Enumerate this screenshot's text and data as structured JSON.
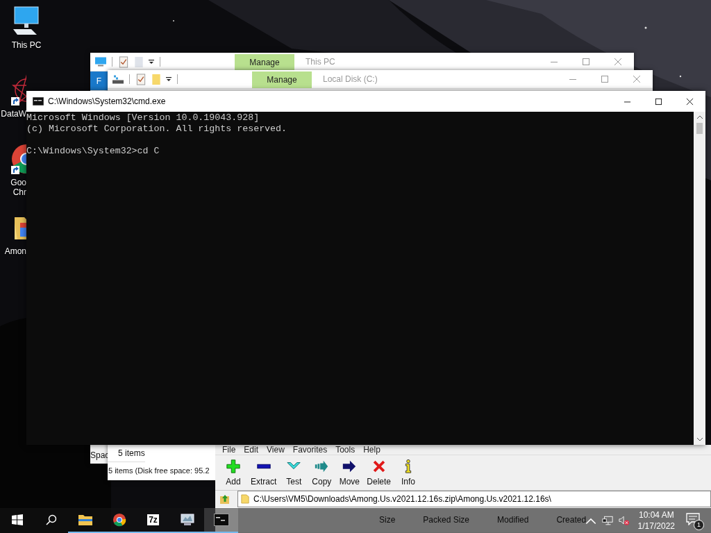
{
  "desktop_icons": [
    {
      "kind": "computer",
      "shortcut": false,
      "label_lines": [
        "This PC"
      ]
    },
    {
      "kind": "app",
      "shortcut": true,
      "label_lines": [
        "DataW"
      ]
    },
    {
      "kind": "chrome",
      "shortcut": true,
      "label_lines": [
        "Goo",
        "Chr"
      ]
    },
    {
      "kind": "folder",
      "shortcut": false,
      "label_lines": [
        "Amon"
      ]
    }
  ],
  "explorer_windows": [
    {
      "title": "This PC",
      "kind": "computer",
      "ribbon_tab": "Manage",
      "file_tab": "F",
      "status_lines": [
        "Spac"
      ]
    },
    {
      "title": "Local Disk (C:)",
      "kind": "drive",
      "ribbon_tab": "Manage",
      "status_lines": [
        "5 items",
        "5 items (Disk free space: 95.2"
      ]
    }
  ],
  "seven_zip": {
    "menu": [
      "File",
      "Edit",
      "View",
      "Favorites",
      "Tools",
      "Help"
    ],
    "tools": [
      {
        "kind": "add",
        "label": "Add"
      },
      {
        "kind": "extract",
        "label": "Extract"
      },
      {
        "kind": "test",
        "label": "Test"
      },
      {
        "kind": "copy",
        "label": "Copy"
      },
      {
        "kind": "move",
        "label": "Move"
      },
      {
        "kind": "delete",
        "label": "Delete"
      },
      {
        "kind": "info",
        "label": "Info"
      }
    ],
    "path": "C:\\Users\\VM5\\Downloads\\Among.Us.v2021.12.16s.zip\\Among.Us.v2021.12.16s\\",
    "columns": [
      "Size",
      "Packed Size",
      "Modified",
      "Created"
    ]
  },
  "console": {
    "title": "C:\\Windows\\System32\\cmd.exe",
    "output": [
      "Microsoft Windows [Version 10.0.19043.928]",
      "(c) Microsoft Corporation. All rights reserved."
    ],
    "prompt": "C:\\Windows\\System32>cd C"
  },
  "taskbar": {
    "apps": [
      {
        "kind": "start",
        "running": false,
        "selected": false
      },
      {
        "kind": "search",
        "running": false,
        "selected": false
      },
      {
        "kind": "explorer",
        "running": true,
        "selected": false
      },
      {
        "kind": "chrome",
        "running": true,
        "selected": false
      },
      {
        "kind": "sevenzip",
        "label": "7z",
        "running": true,
        "selected": false
      },
      {
        "kind": "monitor",
        "running": true,
        "selected": false
      },
      {
        "kind": "console",
        "running": true,
        "selected": true
      }
    ],
    "time": "10:04 AM",
    "date": "1/17/2022",
    "notifications": "1"
  }
}
